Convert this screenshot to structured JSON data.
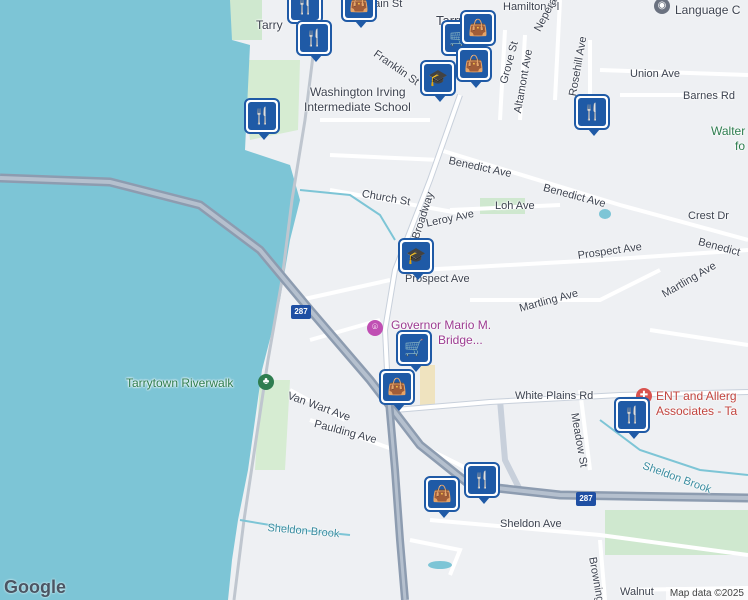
{
  "map": {
    "colors": {
      "water": "#7dc5d6",
      "land": "#eef0f3",
      "road": "#ffffff",
      "highway": "#8d9cb0",
      "park": "#cfe8cf",
      "pin": "#1f5aa6"
    },
    "places": {
      "tarrytown_top": "Tarrytown",
      "tarry_left": "Tarry",
      "language": "Language C",
      "washington_irving": "Washington Irving",
      "intermediate_school": "Intermediate School",
      "walter": "Walter",
      "walter_fo": "fo",
      "governor_bridge_line1": "Governor Mario M.",
      "governor_bridge_line2": "Bridge...",
      "tarrytown_riverwalk": "Tarrytown Riverwalk",
      "ent_line1": "ENT and Allerg",
      "ent_line2": "Associates - Ta"
    },
    "streets": {
      "hamilton": "Hamilton Pl",
      "neperan": "Neperan Rd",
      "grove": "Grove St",
      "franklin": "Franklin St",
      "altamont": "Altamont Ave",
      "rosehill": "Rosehill Ave",
      "union": "Union Ave",
      "barnes": "Barnes Rd",
      "broadway": "Broadway",
      "benedict1": "Benedict Ave",
      "benedict2": "Benedict Ave",
      "benedict3": "Benedict",
      "church": "Church St",
      "leroy": "Leroy Ave",
      "loh": "Loh Ave",
      "crest": "Crest Dr",
      "prospect1": "Prospect Ave",
      "prospect2": "Prospect Ave",
      "martling1": "Martling Ave",
      "martling2": "Martling Ave",
      "white_plains": "White Plains Rd",
      "van_wart": "Van Wart Ave",
      "paulding": "Paulding Ave",
      "meadow": "Meadow St",
      "sheldon_brook1": "Sheldon Brook",
      "sheldon_brook2": "Sheldon Brook",
      "sheldon_ave": "Sheldon Ave",
      "browning": "Browning",
      "walnut": "Walnut",
      "main": "Main St"
    },
    "interstate_1": "287",
    "interstate_2": "287",
    "pins": [
      "restaurant",
      "shopping-bag",
      "restaurant",
      "school",
      "grocery-cart",
      "shopping-bag",
      "restaurant",
      "school",
      "grocery-cart",
      "shopping-bag",
      "restaurant",
      "shopping-bag",
      "restaurant",
      "restaurant",
      "shopping-bag"
    ],
    "google_logo": "Google",
    "attribution": "Map data ©2025"
  }
}
